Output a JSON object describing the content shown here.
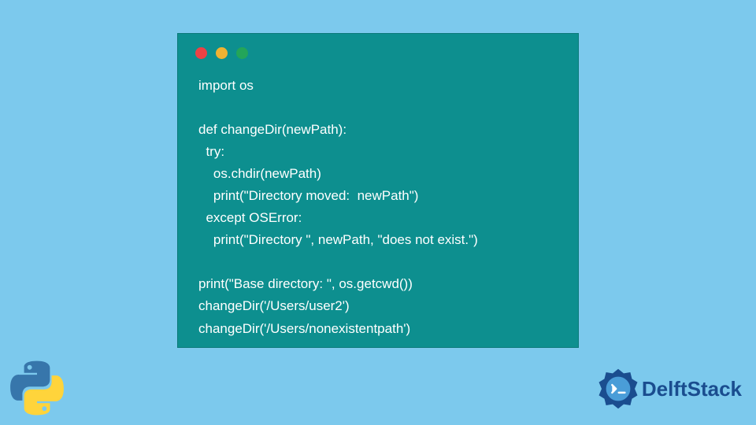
{
  "code": {
    "line1": "import os",
    "line2": "",
    "line3": "def changeDir(newPath):",
    "line4": "  try:",
    "line5": "    os.chdir(newPath)",
    "line6": "    print(\"Directory moved:  newPath\")",
    "line7": "  except OSError:",
    "line8": "    print(\"Directory \", newPath, \"does not exist.\")",
    "line9": "",
    "line10": "print(\"Base directory: \", os.getcwd())",
    "line11": "changeDir('/Users/user2')",
    "line12": "changeDir('/Users/nonexistentpath')"
  },
  "branding": {
    "name": "DelftStack"
  },
  "colors": {
    "background": "#7cc9ed",
    "code_window": "#0d8f8f",
    "dot_red": "#ed4245",
    "dot_yellow": "#f0b232",
    "dot_green": "#23a559",
    "brand_blue": "#1a4d8f"
  }
}
